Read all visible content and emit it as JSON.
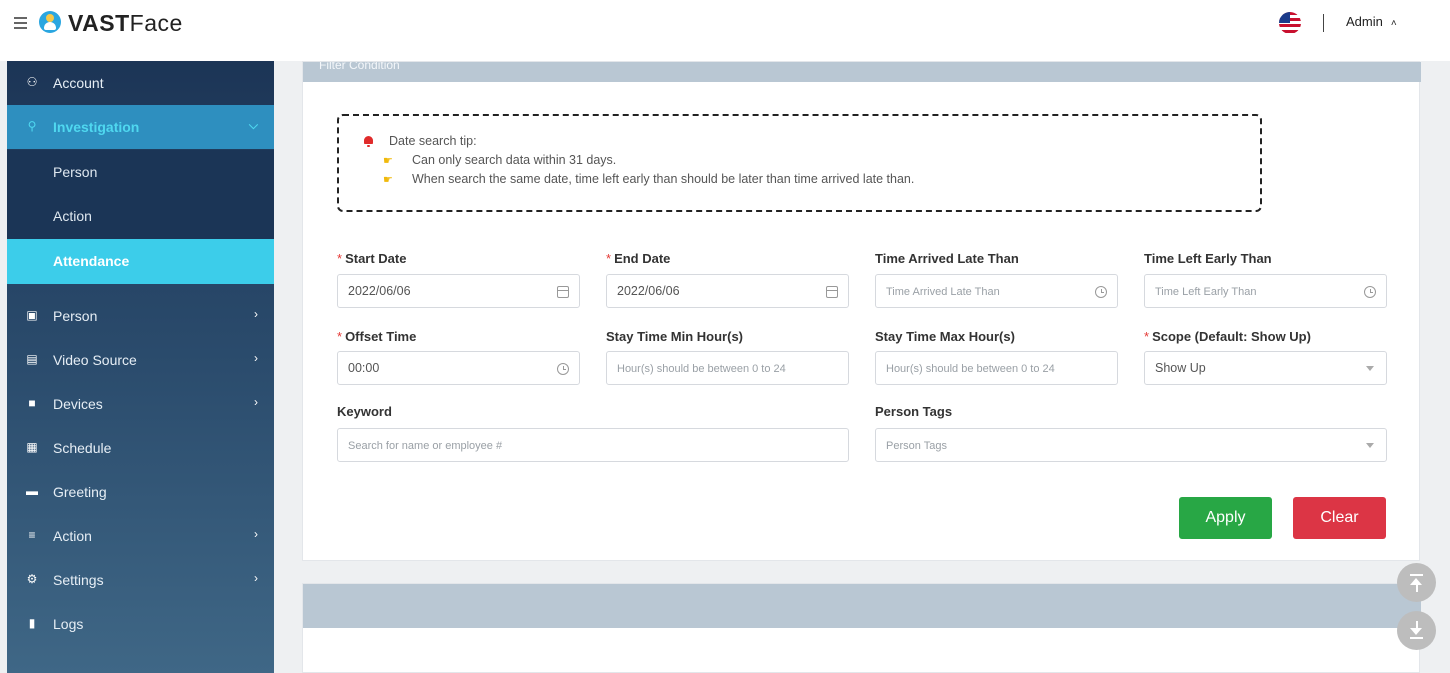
{
  "header": {
    "brand": "VAST",
    "brand_suffix": "Face",
    "user": "Admin"
  },
  "sidebar": {
    "items": [
      {
        "label": "Account",
        "icon": "users-icon"
      },
      {
        "label": "Investigation",
        "icon": "search-icon",
        "expanded": true
      },
      {
        "label": "Person",
        "icon": "id-card-icon"
      },
      {
        "label": "Video Source",
        "icon": "video-source-icon"
      },
      {
        "label": "Devices",
        "icon": "camera-icon"
      },
      {
        "label": "Schedule",
        "icon": "calendar-icon"
      },
      {
        "label": "Greeting",
        "icon": "chat-icon"
      },
      {
        "label": "Action",
        "icon": "list-icon"
      },
      {
        "label": "Settings",
        "icon": "gears-icon"
      },
      {
        "label": "Logs",
        "icon": "clipboard-icon"
      }
    ],
    "investigation_sub": [
      {
        "label": "Person"
      },
      {
        "label": "Action"
      },
      {
        "label": "Attendance",
        "selected": true
      }
    ]
  },
  "filter": {
    "header_title": "Filter Condition",
    "tip_title": "Date search tip:",
    "tips": [
      "Can only search data within 31 days.",
      "When search the same date, time left early than should be later than time arrived late than."
    ],
    "fields": {
      "start_date": {
        "label": "Start Date",
        "value": "2022/06/06",
        "required": true
      },
      "end_date": {
        "label": "End Date",
        "value": "2022/06/06",
        "required": true
      },
      "time_arrived": {
        "label": "Time Arrived Late Than",
        "placeholder": "Time Arrived Late Than"
      },
      "time_left": {
        "label": "Time Left Early Than",
        "placeholder": "Time Left Early Than"
      },
      "offset_time": {
        "label": "Offset Time",
        "value": "00:00",
        "required": true
      },
      "stay_min": {
        "label": "Stay Time Min Hour(s)",
        "placeholder": "Hour(s) should be between 0 to 24"
      },
      "stay_max": {
        "label": "Stay Time Max Hour(s)",
        "placeholder": "Hour(s) should be between 0 to 24"
      },
      "scope": {
        "label": "Scope (Default: Show Up)",
        "value": "Show Up",
        "required": true
      },
      "keyword": {
        "label": "Keyword",
        "placeholder": "Search for name or employee #"
      },
      "person_tags": {
        "label": "Person Tags",
        "placeholder": "Person Tags"
      }
    },
    "apply_label": "Apply",
    "clear_label": "Clear"
  },
  "colors": {
    "apply": "#28a745",
    "clear": "#dc3545",
    "selected_nav": "#3ccdea",
    "panel_header": "#b9c7d3"
  }
}
